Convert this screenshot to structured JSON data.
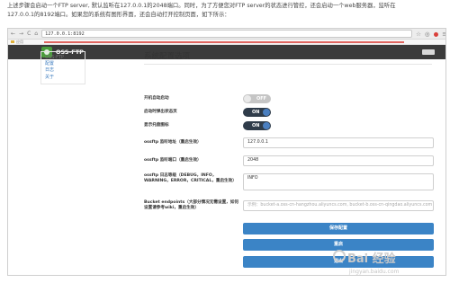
{
  "intro": {
    "line1": "上述步骤会启动一个FTP server, 默认监听在127.0.0.1的2048端口。同时，为了方便您对FTP server的状态进行管控，还会启动一个web服务器，监听在",
    "line2": "127.0.0.1的8192端口。如果您的系统有图形界面，还会自动打开控制页面，如下所示："
  },
  "browser": {
    "url": "127.0.0.1:8192",
    "bookmarks_label": "应用",
    "nav_back": "←",
    "nav_forward": "→",
    "nav_reload": "C",
    "nav_home": "⌂"
  },
  "app": {
    "brand": "OSS-FTP"
  },
  "sidebar": {
    "items": [
      {
        "label": "OSS-FTP"
      },
      {
        "label": "配置"
      },
      {
        "label": "日志"
      },
      {
        "label": "关于"
      }
    ]
  },
  "main": {
    "title": "系统配置选项",
    "fields": {
      "autostart_label": "开机自动启动",
      "autostart_toggle": "OFF",
      "autostart_state": "off",
      "open_browser_label": "启动时弹出状态页",
      "open_browser_toggle": "ON",
      "open_browser_state": "on",
      "tray_icon_label": "显示托盘图标",
      "tray_icon_toggle": "ON",
      "tray_icon_state": "on",
      "listen_addr_label": "ossftp 监听地址（重启生效）",
      "listen_addr_value": "127.0.0.1",
      "listen_port_label": "ossftp 监听端口（重启生效）",
      "listen_port_value": "2048",
      "log_level_label": "ossftp 日志等级（DEBUG，INFO，WARNING，ERROR，CRITICAL，重启生效）",
      "log_level_value": "INFO",
      "bucket_label": "Bucket endpoints（大部分情况无需设置，如何设置请参考wiki，重启生效）",
      "bucket_placeholder": "示例：bucket-a.oss-cn-hangzhou.aliyuncs.com, bucket-b.oss-cn-qingdao.aliyuncs.com"
    },
    "buttons": {
      "save": "保存配置",
      "restart": "重启",
      "exit": "退出"
    }
  },
  "watermark": {
    "text": "Bai 经验",
    "sub": "jingyan.baidu.com"
  },
  "colors": {
    "header_bg": "#3b3b3b",
    "button_blue": "#3b84c6",
    "toggle_on": "#2f3c4a",
    "toggle_off": "#c5c5c5",
    "link": "#3f7ec0"
  }
}
